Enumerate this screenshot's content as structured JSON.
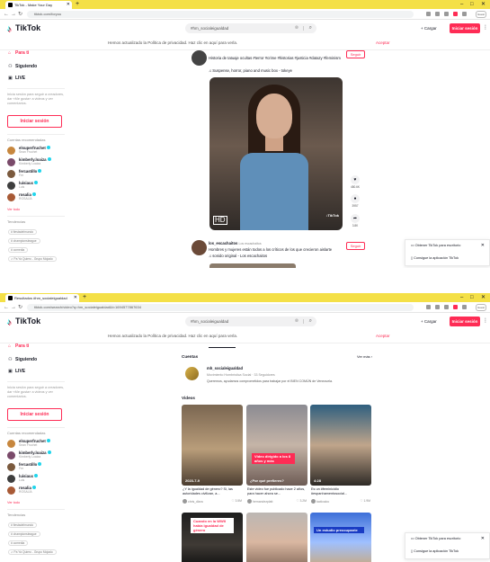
{
  "browser": {
    "tab1_title": "TikTok - Make Your Day",
    "tab2_title": "Resultados #hm_socialeigualdad",
    "url1": "tiktok.com/foryou",
    "url2": "tiktok.com/search/video?q=hm_socialeigualdad&t=1694577867634",
    "profile": "Guest"
  },
  "header": {
    "logo": "TikTok",
    "search_value": "#hm_socialeigualdad",
    "upload": "+ Cargar",
    "login": "Iniciar sesión"
  },
  "notice": {
    "text": "Hemos actualizado la Política de privacidad. Haz clic en aquí para verla.",
    "accept": "Aceptar"
  },
  "sidebar": {
    "nav": [
      "Para ti",
      "Siguiendo",
      "LIVE"
    ],
    "login_desc": "Inicia sesión para seguir a creadores, dar «Me gusta» a videos y ver comentarios.",
    "login_button": "Iniciar sesión",
    "suggested_heading": "Cuentas recomendadas",
    "accounts": [
      {
        "name": "elsuperfruchet",
        "sub": "Sean Fruchet",
        "color": "#c7873e"
      },
      {
        "name": "kimberly.loaiza",
        "sub": "Kimberly Loaiza",
        "color": "#7a4a6a"
      },
      {
        "name": "fercastillo",
        "sub": "Fer",
        "color": "#7b5a3e"
      },
      {
        "name": "luisiaux",
        "sub": "Luis",
        "color": "#3e3e3e"
      },
      {
        "name": "rosalia",
        "sub": "ROSALÍA",
        "color": "#a85a36"
      }
    ],
    "see_all": "Ver todo",
    "discover_heading": "Tendencias",
    "tags": [
      "fiestadelmundo",
      "championsleague",
      "comedia",
      "Pa Ya Quiero - Grupo Mojado"
    ]
  },
  "post1": {
    "desc_line1": "Historia de tatuaje ocultas #terror #crime #historias #justicia #datazy #feminism",
    "music_line": "♫ Suspense, horror, piano and music box - tokeye",
    "follow": "Seguir",
    "watermark": "TikTok",
    "hd": "HD",
    "likes": "480.6K",
    "comments": "3957",
    "shares": "3.8K"
  },
  "post2": {
    "user": "los_escachaitos",
    "user_sub": "Los escachaitos",
    "desc": "Hombres y mujeres están todos a los críticos de los que crecieron aislarte",
    "music": "♫ sonido original - Los escachaitos",
    "follow": "Seguir"
  },
  "popover": {
    "row1": "Obtener TikTok para escritorio",
    "row2": "Consigue la aplicación TikTok"
  },
  "results": {
    "accounts_heading": "Cuentas",
    "see_more": "Ver más",
    "account_name": "mh_socialeigualdad",
    "account_sub": "Movimiento Hombrística Social · 33 Seguidores",
    "account_desc": "Queremos, ayudamos comprometidos para trabajar por el BIEN COMÚN de Venezuela.",
    "videos_heading": "Videos",
    "videos": [
      {
        "overlay": "2023-7-9",
        "caption": "¿Y la igualdad de género? Si, las autoridades civilizan, a...",
        "user": "chris_dlara",
        "likes": "3.5M",
        "bg": "linear-gradient(180deg,#7a6651,#b99d7a 55%,#4b3d30)"
      },
      {
        "overlay": "¿Por qué prefieres?",
        "label": "Video dirigido a los 8 años y más",
        "caption": "Este video fue publicado hace 2 años, para hacer ahora se...",
        "user": "hernandezplatt",
        "likes": "3.2M",
        "bg": "linear-gradient(180deg,#8b8b92,#c5b4a7 50%,#6d5c55)"
      },
      {
        "overlay": "4:28",
        "caption": "Es un #feminicidio #espanhamentosocial...",
        "user": "tacticaloc",
        "likes": "1.9M",
        "bg": "linear-gradient(180deg,#2f5f7f,#c0a58b 50%,#2e2a26)"
      },
      {
        "label": "Cuando en la WWII había igualdad de género",
        "caption": "",
        "user": "",
        "likes": "",
        "bg": "linear-gradient(180deg,#1e1e1e,#3f3a35 60%,#111)"
      },
      {
        "caption": "",
        "user": "",
        "likes": "",
        "bg": "linear-gradient(180deg,#bcb7b4,#d9b7a1 55%,#8a6f5f)"
      },
      {
        "label": "Un estudio preocupante",
        "caption": "",
        "user": "",
        "likes": "",
        "bg": "linear-gradient(180deg,#3d6fd8,#9fc0ff 55%,#c8aa82)"
      }
    ]
  },
  "colors": {
    "brand": "#fe2c55",
    "browser_chrome": "#f4e047",
    "verified": "#20d5ec"
  }
}
